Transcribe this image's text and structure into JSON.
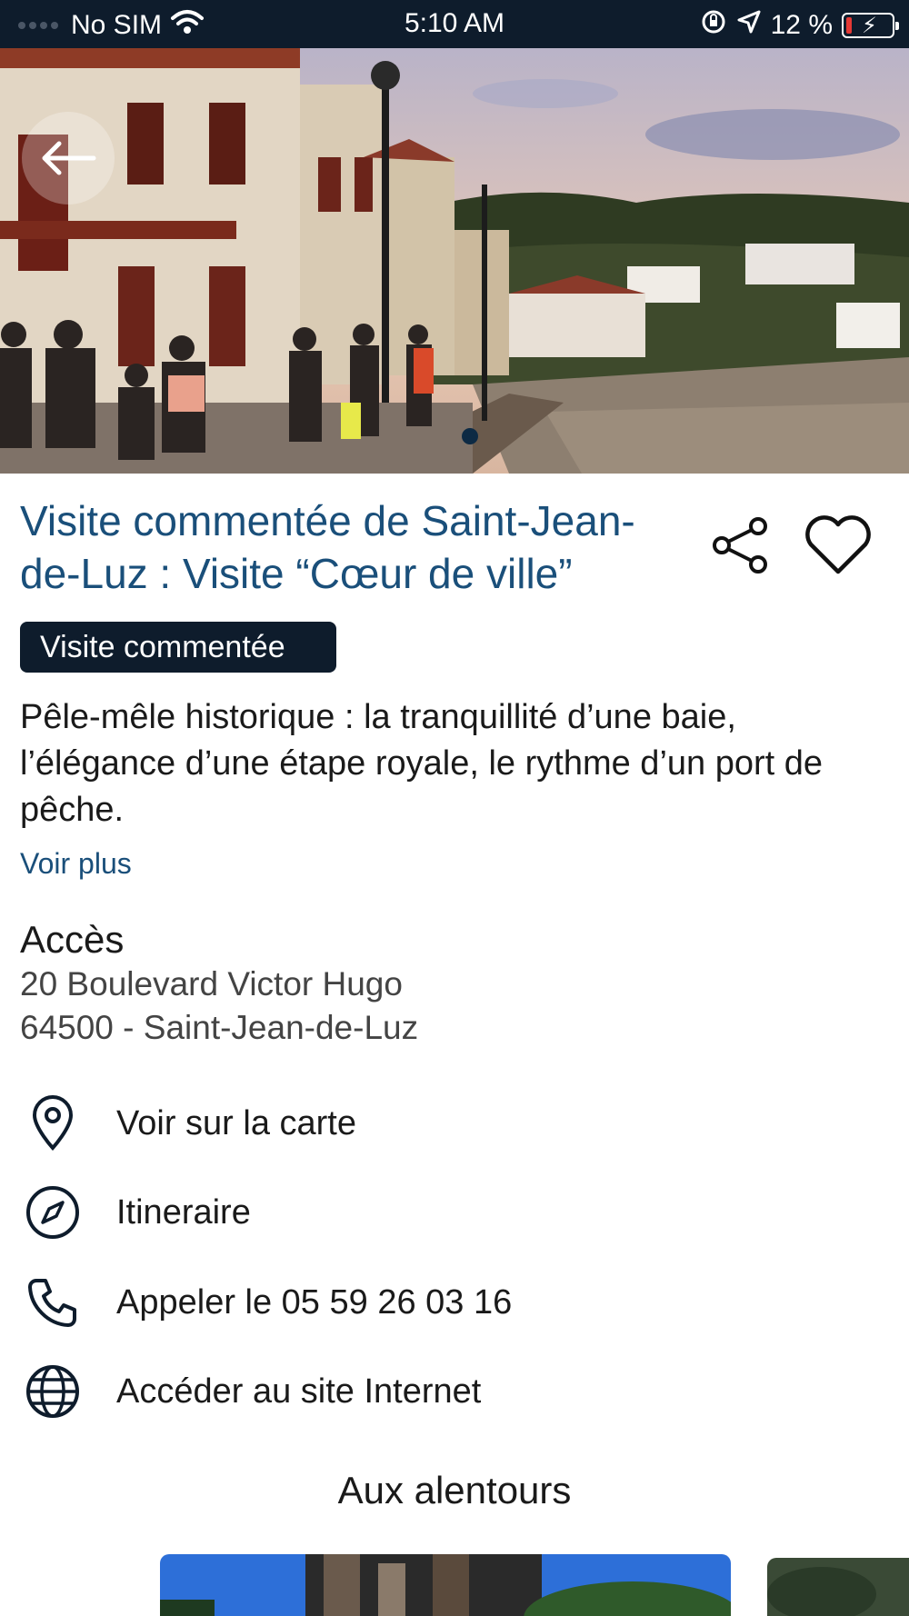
{
  "status_bar": {
    "carrier": "No SIM",
    "time": "5:10 AM",
    "battery": "12 %"
  },
  "detail": {
    "title": "Visite commentée de Saint-Jean-de-Luz : Visite “Cœur de ville”",
    "category_tag": "Visite commentée",
    "description": "Pêle-mêle historique : la tranquillité d’une baie, l’élégance d’une étape royale, le rythme d’un port de pêche.",
    "see_more": "Voir plus"
  },
  "access": {
    "heading": "Accès",
    "address_line1": "20 Boulevard Victor Hugo",
    "address_line2": "64500 - Saint-Jean-de-Luz"
  },
  "actions": [
    {
      "label": "Voir sur la carte",
      "icon": "map-pin-icon"
    },
    {
      "label": "Itineraire",
      "icon": "compass-icon"
    },
    {
      "label": "Appeler le 05 59 26 03 16",
      "icon": "phone-icon"
    },
    {
      "label": "Accéder au site Internet",
      "icon": "globe-icon"
    }
  ],
  "nearby": {
    "heading": "Aux alentours"
  },
  "colors": {
    "accent": "#1a4f7a",
    "dark": "#0e1c2c",
    "battery_low": "#e53935"
  }
}
